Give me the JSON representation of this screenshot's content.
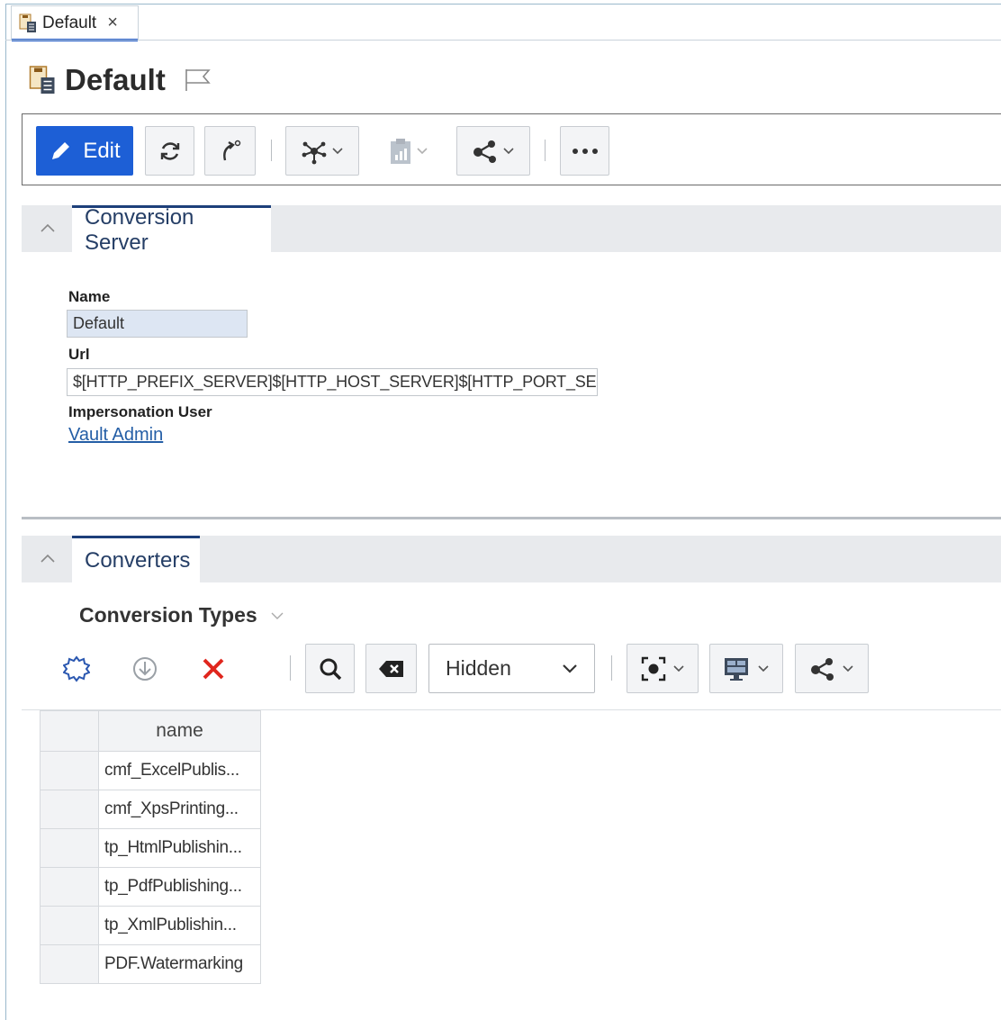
{
  "doc_tab": {
    "label": "Default",
    "close": "×"
  },
  "page": {
    "title": "Default"
  },
  "toolbar": {
    "edit_label": "Edit"
  },
  "sections": {
    "server": {
      "tab_label": "Conversion Server",
      "collapse_glyph": "^"
    },
    "converters": {
      "tab_label": "Converters",
      "collapse_glyph": "^"
    }
  },
  "form": {
    "name_label": "Name",
    "name_value": "Default",
    "url_label": "Url",
    "url_value": "$[HTTP_PREFIX_SERVER]$[HTTP_HOST_SERVER]$[HTTP_PORT_SERVE",
    "user_label": "Impersonation User",
    "user_value": "Vault Admin"
  },
  "converters": {
    "title": "Conversion Types",
    "filter_value": "Hidden",
    "table": {
      "header": "name",
      "rows": [
        "cmf_ExcelPublis...",
        "cmf_XpsPrinting...",
        "tp_HtmlPublishin...",
        "tp_PdfPublishing...",
        "tp_XmlPublishin...",
        "PDF.Watermarking"
      ]
    }
  },
  "colors": {
    "accent": "#1d5fd6",
    "section_tab_border": "#1d3f7a",
    "link": "#245ea6",
    "delete": "#e0261d"
  }
}
